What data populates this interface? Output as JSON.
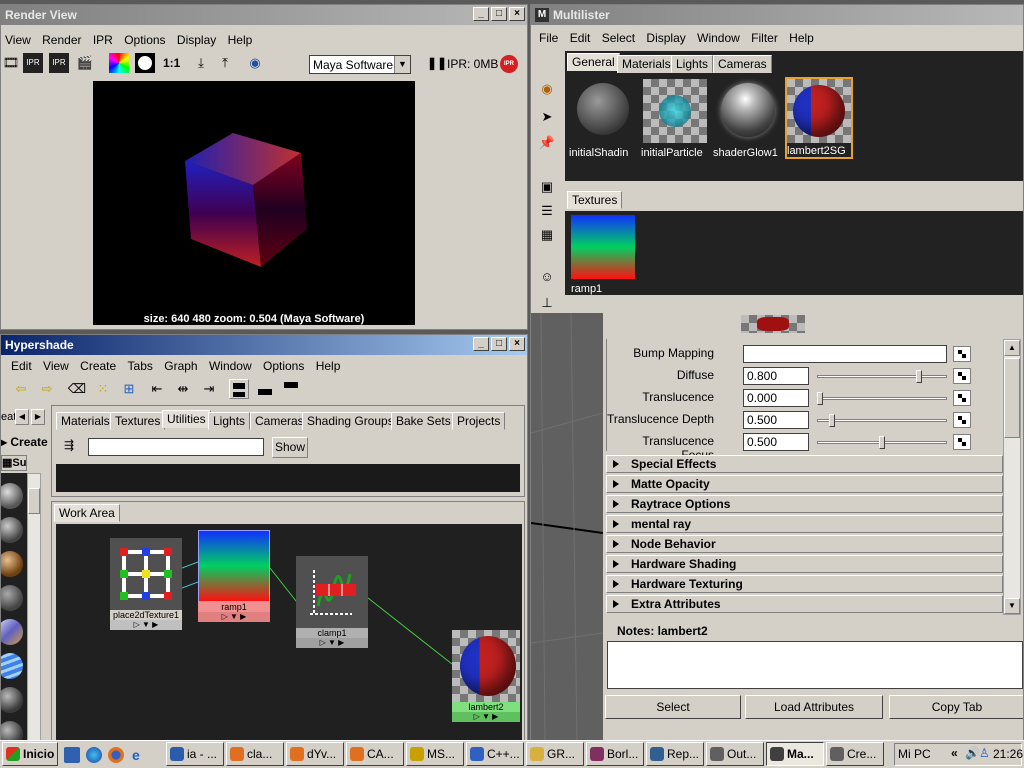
{
  "render_view": {
    "title": "Render View",
    "menu": [
      "View",
      "Render",
      "IPR",
      "Options",
      "Display",
      "Help"
    ],
    "ratio": "1:1",
    "renderer": "Maya Software",
    "ipr_status": "IPR: 0MB",
    "info": "size:  640  480 zoom: 0.504  (Maya Software)"
  },
  "multilister": {
    "title": "Multilister",
    "menu": [
      "File",
      "Edit",
      "Select",
      "Display",
      "Window",
      "Filter",
      "Help"
    ],
    "tabs": [
      "General",
      "Materials",
      "Lights",
      "Cameras"
    ],
    "selected_tab": "General",
    "swatches": [
      {
        "label": "initialShadin",
        "kind": "grey-ball"
      },
      {
        "label": "initialParticle",
        "kind": "checker-cyan"
      },
      {
        "label": "shaderGlow1",
        "kind": "glow-ball"
      },
      {
        "label": "lambert2SG",
        "kind": "checker-redblue"
      }
    ],
    "textures_tab": "Textures",
    "texture_swatch": {
      "label": "ramp1"
    }
  },
  "attribute_editor": {
    "bump_label": "Bump Mapping",
    "rows": [
      {
        "label": "Diffuse",
        "value": "0.800",
        "slider": 0.8
      },
      {
        "label": "Translucence",
        "value": "0.000",
        "slider": 0.0
      },
      {
        "label": "Translucence Depth",
        "value": "0.500",
        "slider": 0.1
      },
      {
        "label": "Translucence Focus",
        "value": "0.500",
        "slider": 0.5
      }
    ],
    "frames": [
      "Special Effects",
      "Matte Opacity",
      "Raytrace Options",
      "mental ray",
      "Node Behavior",
      "Hardware Shading",
      "Hardware Texturing",
      "Extra Attributes"
    ],
    "notes_label": "Notes: lambert2",
    "buttons": [
      "Select",
      "Load Attributes",
      "Copy Tab"
    ]
  },
  "hypershade": {
    "title": "Hypershade",
    "menu": [
      "Edit",
      "View",
      "Create",
      "Tabs",
      "Graph",
      "Window",
      "Options",
      "Help"
    ],
    "left_tab_text": "eat",
    "create_label": "Create",
    "sub_label": "Su",
    "tabs": [
      "Materials",
      "Textures",
      "Utilities",
      "Lights",
      "Cameras",
      "Shading Groups",
      "Bake Sets",
      "Projects"
    ],
    "selected_tab": "Utilities",
    "search_value": "",
    "show_button": "Show",
    "work_area_tab": "Work Area",
    "nodes": [
      "place2dTexture1",
      "ramp1",
      "clamp1",
      "lambert2"
    ]
  },
  "taskbar": {
    "start": "Inicio",
    "tasks": [
      {
        "label": "ia - ...",
        "color": "#2a5caa"
      },
      {
        "label": "cla...",
        "color": "#e07020"
      },
      {
        "label": "dYv...",
        "color": "#e07020"
      },
      {
        "label": "CA...",
        "color": "#e07020"
      },
      {
        "label": "MS...",
        "color": "#c8a000"
      },
      {
        "label": "C++...",
        "color": "#3060c0"
      },
      {
        "label": "GR...",
        "color": "#d8b040"
      },
      {
        "label": "Borl...",
        "color": "#803060"
      },
      {
        "label": "Rep...",
        "color": "#306090"
      },
      {
        "label": "Out...",
        "color": "#606060"
      },
      {
        "label": "Ma...",
        "color": "#404040",
        "active": true
      },
      {
        "label": "Cre...",
        "color": "#606060"
      }
    ],
    "tray_label": "Mi PC",
    "clock": "21:26"
  }
}
